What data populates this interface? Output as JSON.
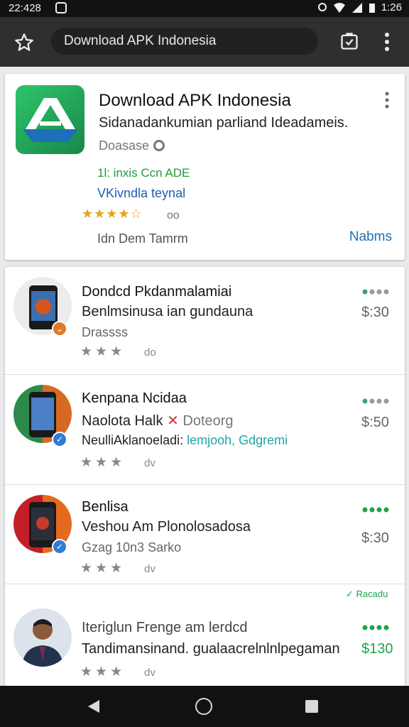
{
  "status_bar": {
    "time_left": "22:428",
    "time_right": "1:26"
  },
  "browser": {
    "url": "Download APK Indonesia"
  },
  "featured": {
    "title": "Download APK Indonesia",
    "subtitle": "Sidanadankumian parliand Ideadameis.",
    "developer": "Doasase",
    "green_text": "1l: inxis Ccn ADE",
    "blue_text": "VKivndla teynal",
    "stars": "★★★★☆",
    "rating_count": "oo",
    "footer": "Idn Dem Tamrm",
    "action": "Nabms"
  },
  "list": [
    {
      "title": "Dondcd Pkdanmalamiai",
      "subtitle": "Benlmsinusa ian gundauna",
      "meta": "Drassss",
      "stars": "★★★",
      "count": "do",
      "price": "$:30",
      "price_green": false,
      "meta_accent": ""
    },
    {
      "title": "Kenpana Ncidaa",
      "subtitle": "Naolota Halk",
      "subtitle_accent": "Doteorg",
      "meta": "NeulliAklanoeladi:",
      "meta_accent": "lemjooh, Gdgremi",
      "stars": "★★★",
      "count": "dv",
      "price": "$:50",
      "price_green": false
    },
    {
      "title": "Benlisa",
      "subtitle": "Veshou Am Plonolosadosa",
      "meta": "Gzag 10n3 Sarko",
      "stars": "★★★",
      "count": "dv",
      "price": "$:30",
      "price_green": false,
      "meta_accent": "",
      "tag": "Racadu"
    },
    {
      "title": "Iteriglun Frenge am lerdcd",
      "subtitle": "Tandimansinand. gualaacrelnlnlpegaman",
      "meta": "",
      "stars": "★★★",
      "count": "dv",
      "price": "$130",
      "price_green": true,
      "meta_accent": ""
    }
  ],
  "colors": {
    "accent_green": "#1fa34b",
    "accent_blue": "#1f6fb4",
    "star_gold": "#e8a417"
  }
}
